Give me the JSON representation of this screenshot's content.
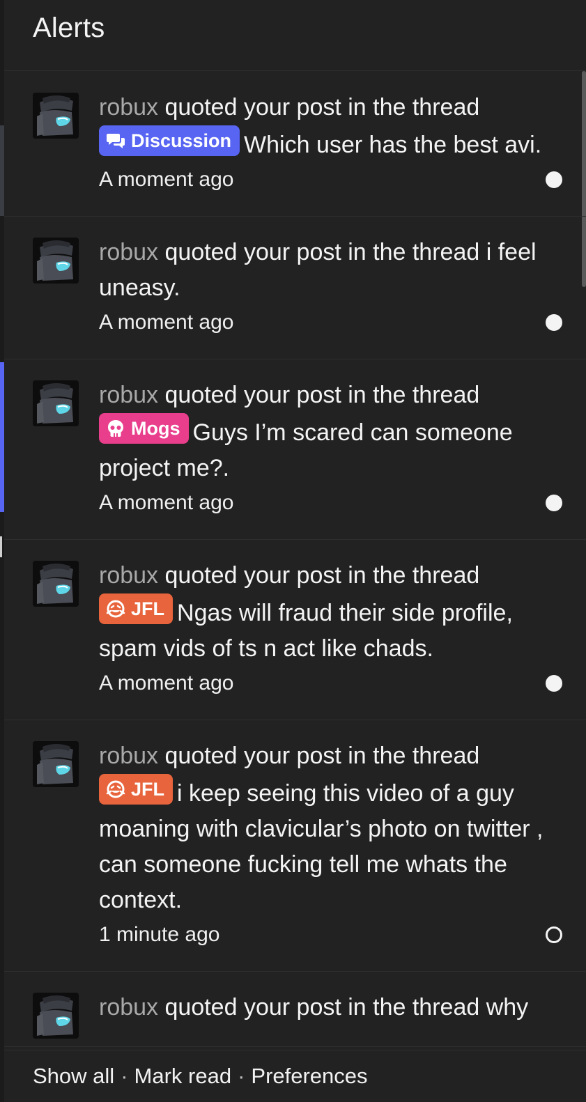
{
  "panel": {
    "title": "Alerts"
  },
  "alerts": [
    {
      "username": "robux",
      "action": " quoted your post in the thread ",
      "prefix": {
        "label": "Discussion",
        "icon": "chat-bubbles-icon",
        "color": "#5865f2"
      },
      "thread_title": "Which user has the best avi.",
      "time": "A moment ago",
      "read": false
    },
    {
      "username": "robux",
      "action": " quoted your post in the thread ",
      "prefix": null,
      "thread_title": "i feel uneasy.",
      "time": "A moment ago",
      "read": false
    },
    {
      "username": "robux",
      "action": " quoted your post in the thread ",
      "prefix": {
        "label": "Mogs",
        "icon": "skull-icon",
        "color": "#e83e8c"
      },
      "thread_title": "Guys I’m scared can someone project me?.",
      "time": "A moment ago",
      "read": false
    },
    {
      "username": "robux",
      "action": " quoted your post in the thread ",
      "prefix": {
        "label": "JFL",
        "icon": "laughing-face-icon",
        "color": "#e8643c"
      },
      "thread_title": "Ngas will fraud their side profile, spam vids of ts n act like chads.",
      "time": "A moment ago",
      "read": false
    },
    {
      "username": "robux",
      "action": " quoted your post in the thread ",
      "prefix": {
        "label": "JFL",
        "icon": "laughing-face-icon",
        "color": "#e8643c"
      },
      "thread_title": "i keep seeing this video of a guy moaning with clavicular’s photo on twitter , can someone fucking tell me whats the context.",
      "time": "1 minute ago",
      "read": true
    },
    {
      "username": "robux",
      "action": " quoted your post in the thread ",
      "prefix": null,
      "thread_title": "why",
      "time": "",
      "read": false
    }
  ],
  "footer": {
    "show_all": "Show all",
    "mark_read": "Mark read",
    "preferences": "Preferences",
    "separator": "·"
  },
  "colors": {
    "panel_bg": "#222222",
    "username": "#a9a9a9",
    "text": "#f4f4f4"
  }
}
